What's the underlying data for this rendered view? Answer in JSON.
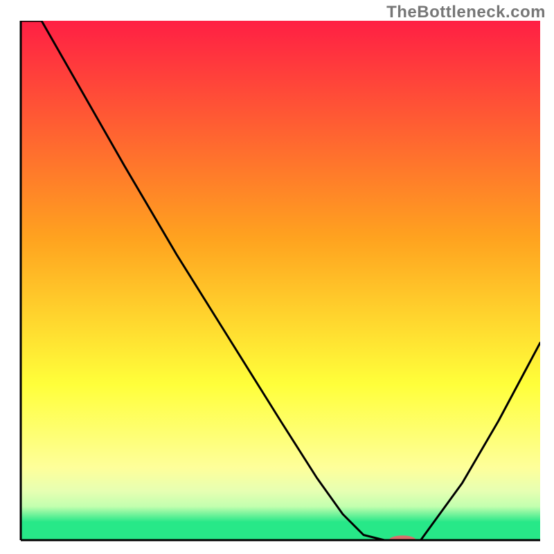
{
  "watermark": "TheBottleneck.com",
  "colors": {
    "black": "#000000",
    "marker": "#d9706c",
    "red": "#ff1f44",
    "orange": "#ffa31f",
    "yellow": "#ffff3a",
    "paleyellow": "#feff9a",
    "cream": "#e7ffb2",
    "ygreen": "#c3ffaf",
    "green": "#27e888"
  },
  "plot": {
    "x0": 30,
    "y0": 30,
    "x1": 780,
    "y1": 780
  },
  "chart_data": {
    "type": "line",
    "title": "",
    "xlabel": "",
    "ylabel": "",
    "xlim": [
      0,
      100
    ],
    "ylim": [
      0,
      100
    ],
    "grid": false,
    "note": "x is relative position across width; y is relative height where 0 = bottom axis, 100 = top edge. Values are read off the rendered curve.",
    "series": [
      {
        "name": "curve",
        "x": [
          0,
          4,
          20,
          30,
          40,
          50,
          57,
          62,
          66,
          70,
          77,
          85,
          92,
          100
        ],
        "y": [
          100,
          100,
          72,
          55,
          39,
          23,
          12,
          5,
          1,
          0,
          0,
          11,
          23,
          38
        ]
      }
    ],
    "marker": {
      "name": "sweet-spot",
      "x": 73.5,
      "y": 0,
      "rx_pct": 2.6,
      "ry_pct": 0.9
    }
  }
}
